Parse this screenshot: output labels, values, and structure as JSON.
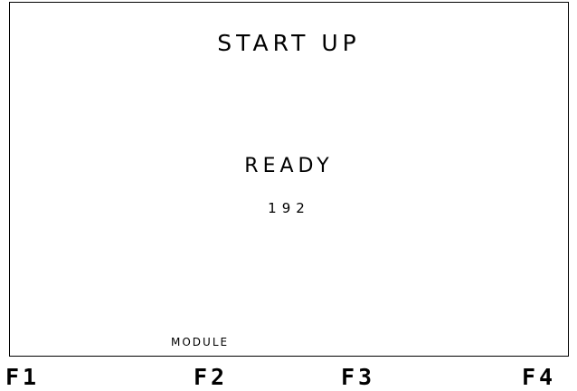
{
  "screen": {
    "title": "START UP",
    "status": "READY",
    "value": "192"
  },
  "softkeys": {
    "f1_label": "",
    "f2_label": "MODULE",
    "f3_label": "",
    "f4_label": ""
  },
  "function_keys": [
    "F1",
    "F2",
    "F3",
    "F4"
  ]
}
